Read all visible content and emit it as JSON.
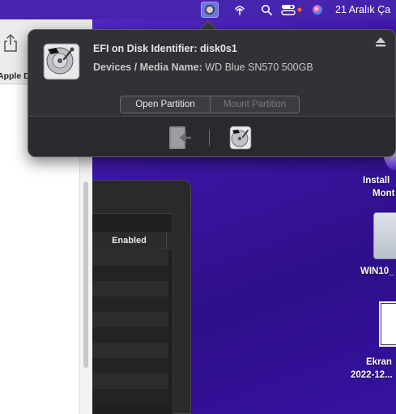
{
  "menubar": {
    "date_label": "21 Aralık Ça",
    "icons": [
      "efi-agent-icon",
      "wifi-icon",
      "search-icon",
      "control-center-icon",
      "siri-icon"
    ]
  },
  "left_window": {
    "label": "Apple D"
  },
  "table": {
    "header": "Enabled",
    "row_count": 10
  },
  "desktop_icons": [
    {
      "label_line1": "Install",
      "label_line2": "Mont"
    },
    {
      "label_line1": "WIN10_"
    },
    {
      "label_line1": "Ekran",
      "label_line2": "2022-12..."
    }
  ],
  "popover": {
    "title_line": "EFI on Disk Identifier: disk0s1",
    "media_key": "Devices / Media Name:",
    "media_value": "WD Blue SN570 500GB",
    "open_button": "Open Partition",
    "mount_button": "Mount Partition"
  },
  "colors": {
    "accent": "#6b74e0",
    "popover_bg": "#3a3a3e",
    "wallpaper": "#3e17a8"
  }
}
